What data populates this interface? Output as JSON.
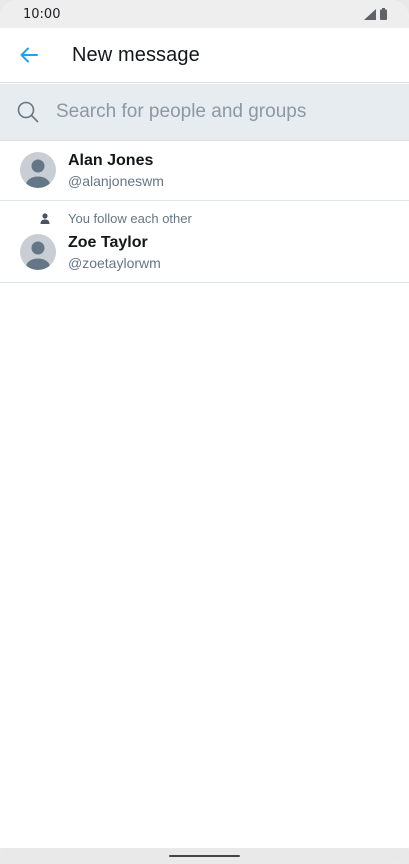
{
  "status_bar": {
    "time": "10:00"
  },
  "header": {
    "title": "New message"
  },
  "search": {
    "placeholder": "Search for people and groups"
  },
  "results": [
    {
      "name": "Alan Jones",
      "handle": "@alanjoneswm"
    },
    {
      "social_context": "You follow each other",
      "name": "Zoe Taylor",
      "handle": "@zoetaylorwm"
    }
  ],
  "colors": {
    "accent": "#1da1f2",
    "search_bg": "#e6ecf0",
    "secondary_text": "#657786"
  },
  "icons": {
    "back": "arrow-left-icon",
    "search": "search-icon",
    "signal": "signal-icon",
    "battery": "battery-icon",
    "person": "person-icon"
  }
}
